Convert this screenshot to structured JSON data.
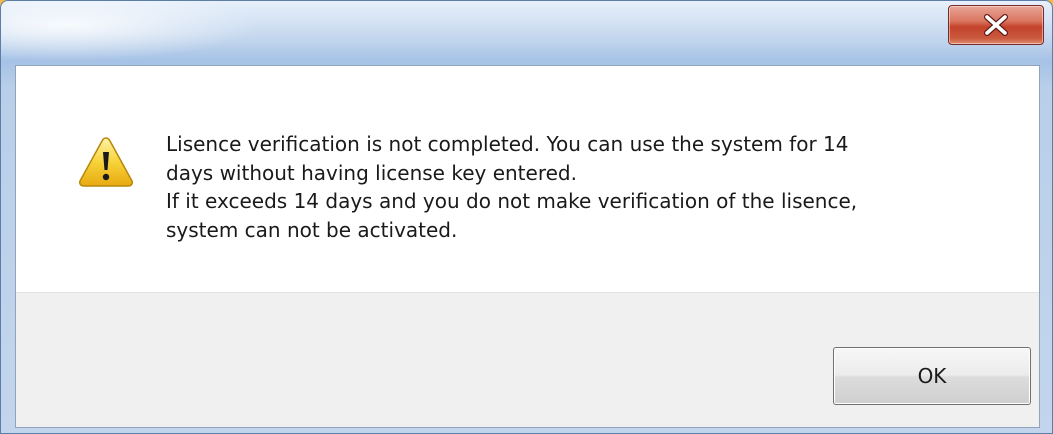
{
  "dialog": {
    "title": "",
    "close_icon": "close-icon",
    "icon": "warning-icon",
    "message_lines": [
      "Lisence verification is not completed. You can use the system for 14",
      "days without having license key entered.",
      "If it exceeds 14 days and you do not make verification of the lisence,",
      "system can not be activated."
    ],
    "ok_label": "OK"
  },
  "colors": {
    "close_button": "#c4432b",
    "warning_icon": "#f5c518",
    "footer_bg": "#f0f0f0"
  }
}
